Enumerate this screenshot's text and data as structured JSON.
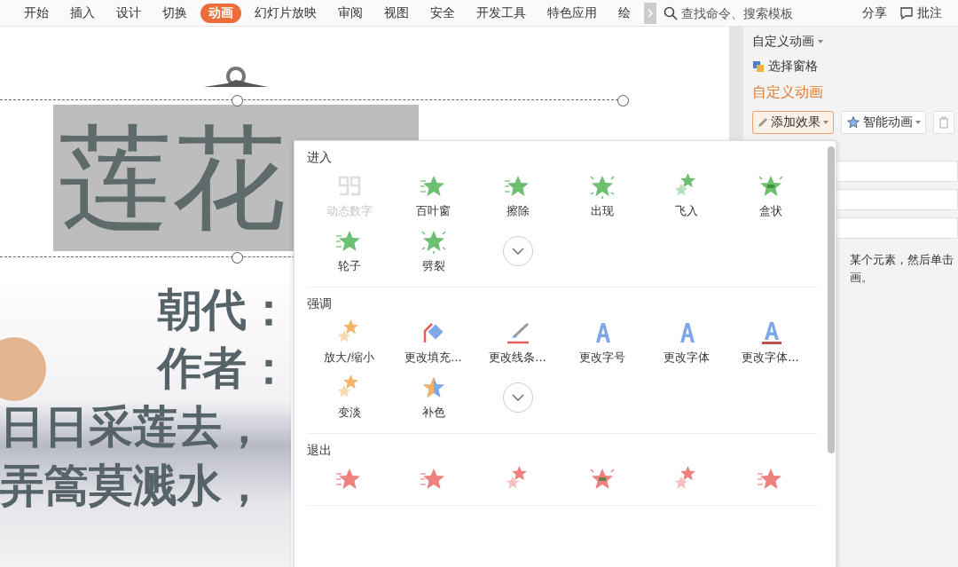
{
  "ribbon": {
    "tabs": [
      {
        "label": "开始",
        "selected": false
      },
      {
        "label": "插入",
        "selected": false
      },
      {
        "label": "设计",
        "selected": false
      },
      {
        "label": "切换",
        "selected": false
      },
      {
        "label": "动画",
        "selected": true
      },
      {
        "label": "幻灯片放映",
        "selected": false
      },
      {
        "label": "审阅",
        "selected": false
      },
      {
        "label": "视图",
        "selected": false
      },
      {
        "label": "安全",
        "selected": false
      },
      {
        "label": "开发工具",
        "selected": false
      },
      {
        "label": "特色应用",
        "selected": false
      },
      {
        "label": "绘",
        "selected": false
      }
    ],
    "search": {
      "placeholder": "查找命令、搜索模板"
    },
    "actions": [
      {
        "label": "分享",
        "kind": "text"
      },
      {
        "label": "批注",
        "kind": "comment"
      }
    ]
  },
  "slide": {
    "title": "莲花",
    "lines": [
      {
        "text": "朝代：",
        "kind": "meta"
      },
      {
        "text": "作者：",
        "kind": "meta"
      },
      {
        "text": "日日采莲去，",
        "kind": "verse"
      },
      {
        "text": "弄篙莫溅水，",
        "kind": "verse"
      }
    ]
  },
  "task_pane": {
    "menu": "自定义动画",
    "selection_pane": "选择窗格",
    "heading": "自定义动画",
    "buttons": [
      {
        "label": "添加效果",
        "kind": "add",
        "pressed": true
      },
      {
        "label": "智能动画",
        "kind": "smart",
        "pressed": false
      },
      {
        "kind": "delete"
      }
    ],
    "hint": [
      "某个元素，然后单击",
      "画。"
    ]
  },
  "effects_menu": {
    "sections": [
      {
        "title": "进入",
        "color": "#6cc070",
        "items": [
          {
            "label": "动态数字",
            "kind": "digits",
            "disabled": true
          },
          {
            "label": "百叶窗",
            "kind": "star-lines",
            "disabled": false
          },
          {
            "label": "擦除",
            "kind": "star-lines",
            "disabled": false
          },
          {
            "label": "出现",
            "kind": "star-rays",
            "disabled": false
          },
          {
            "label": "飞入",
            "kind": "star-double",
            "disabled": false
          },
          {
            "label": "盒状",
            "kind": "star-box",
            "disabled": false
          },
          {
            "label": "轮子",
            "kind": "star-lines",
            "disabled": false
          },
          {
            "label": "劈裂",
            "kind": "star-rays",
            "disabled": false
          }
        ]
      },
      {
        "title": "强调",
        "color": "#f4b366",
        "items": [
          {
            "label": "放大/缩小",
            "kind": "star-double",
            "disabled": false
          },
          {
            "label": "更改填充...",
            "kind": "fill",
            "disabled": false
          },
          {
            "label": "更改线条...",
            "kind": "line",
            "disabled": false
          },
          {
            "label": "更改字号",
            "kind": "letter",
            "disabled": false
          },
          {
            "label": "更改字体",
            "kind": "letter",
            "disabled": false
          },
          {
            "label": "更改字体...",
            "kind": "letter-underline",
            "disabled": false
          },
          {
            "label": "变淡",
            "kind": "star-double",
            "disabled": false
          },
          {
            "label": "补色",
            "kind": "star-two-tone",
            "disabled": false
          }
        ]
      },
      {
        "title": "退出",
        "color": "#ee8080",
        "items": [
          {
            "kind": "star-lines"
          },
          {
            "kind": "star-lines"
          },
          {
            "kind": "star-double"
          },
          {
            "kind": "star-box"
          },
          {
            "kind": "star-double"
          },
          {
            "kind": "star-lines"
          }
        ]
      }
    ]
  }
}
